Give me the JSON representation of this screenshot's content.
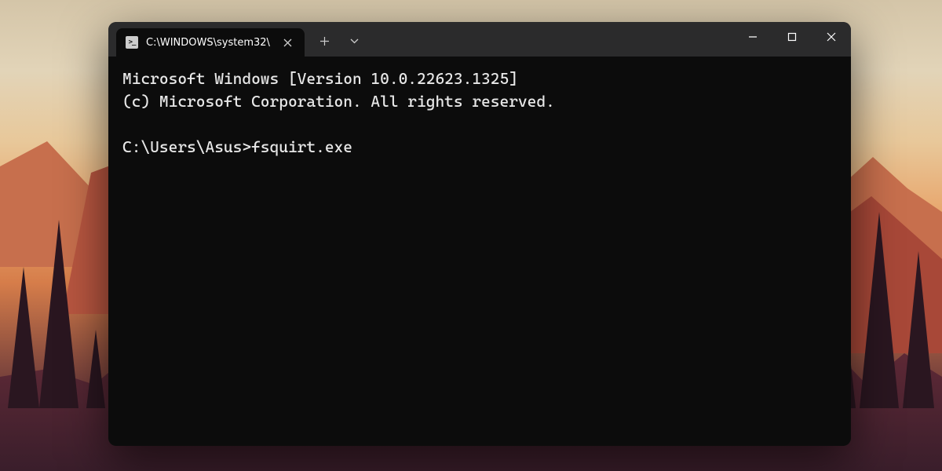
{
  "tab": {
    "title": "C:\\WINDOWS\\system32\\"
  },
  "terminal": {
    "line1": "Microsoft Windows [Version 10.0.22623.1325]",
    "line2": "(c) Microsoft Corporation. All rights reserved.",
    "prompt": "C:\\Users\\Asus>",
    "command": "fsquirt.exe"
  }
}
